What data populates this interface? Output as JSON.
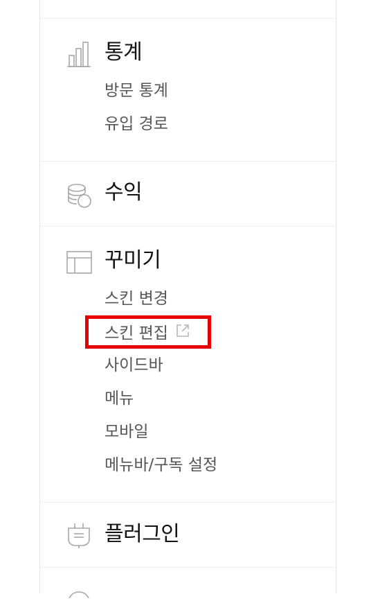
{
  "sections": {
    "stats": {
      "title": "통계",
      "items": [
        "방문 통계",
        "유입 경로"
      ],
      "icon": "bar-chart-icon"
    },
    "revenue": {
      "title": "수익",
      "icon": "coins-icon"
    },
    "decorate": {
      "title": "꾸미기",
      "icon": "layout-icon",
      "items": [
        "스킨 변경",
        "스킨 편집",
        "사이드바",
        "메뉴",
        "모바일",
        "메뉴바/구독 설정"
      ]
    },
    "plugin": {
      "title": "플러그인",
      "icon": "plug-icon"
    }
  },
  "colors": {
    "highlight": "#e80000",
    "divider": "#eceef1",
    "item_text": "#555555",
    "icon": "#a6a6a6"
  }
}
